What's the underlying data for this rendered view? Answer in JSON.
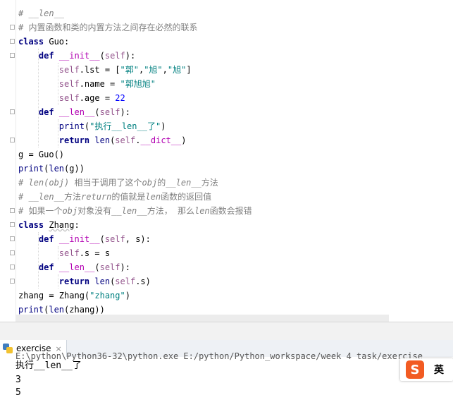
{
  "editor": {
    "lines": [
      {
        "parts": [
          {
            "t": "# __len__",
            "c": "cm"
          }
        ]
      },
      {
        "parts": [
          {
            "t": "# 内置函数和类的内置方法之间存在必然的联系",
            "c": "cmz"
          }
        ]
      },
      {
        "parts": [
          {
            "t": "class ",
            "c": "kw"
          },
          {
            "t": "Guo",
            "c": "cls-def"
          },
          {
            "t": ":",
            "c": ""
          }
        ]
      },
      {
        "parts": [
          {
            "t": "    ",
            "c": ""
          },
          {
            "t": "def ",
            "c": "kw"
          },
          {
            "t": "__init__",
            "c": "fn-special"
          },
          {
            "t": "(",
            "c": ""
          },
          {
            "t": "self",
            "c": "slf"
          },
          {
            "t": "):",
            "c": ""
          }
        ]
      },
      {
        "parts": [
          {
            "t": "        ",
            "c": ""
          },
          {
            "t": "self",
            "c": "slf"
          },
          {
            "t": ".lst = [",
            "c": ""
          },
          {
            "t": "\"郭\"",
            "c": "str"
          },
          {
            "t": ",",
            "c": ""
          },
          {
            "t": "\"旭\"",
            "c": "str"
          },
          {
            "t": ",",
            "c": ""
          },
          {
            "t": "\"旭\"",
            "c": "str"
          },
          {
            "t": "]",
            "c": ""
          }
        ]
      },
      {
        "parts": [
          {
            "t": "        ",
            "c": ""
          },
          {
            "t": "self",
            "c": "slf"
          },
          {
            "t": ".name = ",
            "c": ""
          },
          {
            "t": "\"郭旭旭\"",
            "c": "str"
          }
        ]
      },
      {
        "parts": [
          {
            "t": "        ",
            "c": ""
          },
          {
            "t": "self",
            "c": "slf"
          },
          {
            "t": ".age = ",
            "c": ""
          },
          {
            "t": "22",
            "c": "num"
          }
        ]
      },
      {
        "parts": [
          {
            "t": "    ",
            "c": ""
          },
          {
            "t": "def ",
            "c": "kw"
          },
          {
            "t": "__len__",
            "c": "fn-special"
          },
          {
            "t": "(",
            "c": ""
          },
          {
            "t": "self",
            "c": "slf"
          },
          {
            "t": "):",
            "c": ""
          }
        ]
      },
      {
        "parts": [
          {
            "t": "        ",
            "c": ""
          },
          {
            "t": "print",
            "c": "bi"
          },
          {
            "t": "(",
            "c": ""
          },
          {
            "t": "\"执行__len__了\"",
            "c": "str"
          },
          {
            "t": ")",
            "c": ""
          }
        ]
      },
      {
        "parts": [
          {
            "t": "        ",
            "c": ""
          },
          {
            "t": "return ",
            "c": "kw"
          },
          {
            "t": "len",
            "c": "bi"
          },
          {
            "t": "(",
            "c": ""
          },
          {
            "t": "self",
            "c": "slf"
          },
          {
            "t": ".",
            "c": ""
          },
          {
            "t": "__dict__",
            "c": "fn-special"
          },
          {
            "t": ")",
            "c": ""
          }
        ]
      },
      {
        "parts": [
          {
            "t": "g = Guo()",
            "c": ""
          }
        ]
      },
      {
        "parts": [
          {
            "t": "print",
            "c": "bi"
          },
          {
            "t": "(",
            "c": ""
          },
          {
            "t": "len",
            "c": "bi"
          },
          {
            "t": "(g))",
            "c": ""
          }
        ]
      },
      {
        "parts": [
          {
            "t": "# len(obj) ",
            "c": "cm"
          },
          {
            "t": "相当于调用了这个",
            "c": "cmz"
          },
          {
            "t": "obj",
            "c": "cm"
          },
          {
            "t": "的",
            "c": "cmz"
          },
          {
            "t": "__len__",
            "c": "cm"
          },
          {
            "t": "方法",
            "c": "cmz"
          }
        ]
      },
      {
        "parts": [
          {
            "t": "# __len__",
            "c": "cm"
          },
          {
            "t": "方法",
            "c": "cmz"
          },
          {
            "t": "return",
            "c": "cm"
          },
          {
            "t": "的值就是",
            "c": "cmz"
          },
          {
            "t": "len",
            "c": "cm"
          },
          {
            "t": "函数的返回值",
            "c": "cmz"
          }
        ]
      },
      {
        "parts": [
          {
            "t": "# 如果一个",
            "c": "cmz"
          },
          {
            "t": "obj",
            "c": "cm"
          },
          {
            "t": "对象没有",
            "c": "cmz"
          },
          {
            "t": "__len__",
            "c": "cm"
          },
          {
            "t": "方法， 那么",
            "c": "cmz"
          },
          {
            "t": "len",
            "c": "cm"
          },
          {
            "t": "函数会报错",
            "c": "cmz"
          }
        ]
      },
      {
        "parts": [
          {
            "t": "class ",
            "c": "kw"
          },
          {
            "t": "Zhang",
            "c": "cls-def underline-warn"
          },
          {
            "t": ":",
            "c": ""
          }
        ]
      },
      {
        "parts": [
          {
            "t": "    ",
            "c": ""
          },
          {
            "t": "def ",
            "c": "kw"
          },
          {
            "t": "__init__",
            "c": "fn-special"
          },
          {
            "t": "(",
            "c": ""
          },
          {
            "t": "self",
            "c": "slf"
          },
          {
            "t": ", s):",
            "c": ""
          }
        ]
      },
      {
        "parts": [
          {
            "t": "        ",
            "c": ""
          },
          {
            "t": "self",
            "c": "slf"
          },
          {
            "t": ".s = s",
            "c": ""
          }
        ]
      },
      {
        "parts": [
          {
            "t": "    ",
            "c": ""
          },
          {
            "t": "def ",
            "c": "kw"
          },
          {
            "t": "__len__",
            "c": "fn-special"
          },
          {
            "t": "(",
            "c": ""
          },
          {
            "t": "self",
            "c": "slf"
          },
          {
            "t": "):",
            "c": ""
          }
        ]
      },
      {
        "parts": [
          {
            "t": "        ",
            "c": ""
          },
          {
            "t": "return ",
            "c": "kw"
          },
          {
            "t": "len",
            "c": "bi"
          },
          {
            "t": "(",
            "c": ""
          },
          {
            "t": "self",
            "c": "slf"
          },
          {
            "t": ".s)",
            "c": ""
          }
        ]
      },
      {
        "parts": [
          {
            "t": "zhang = Zhang(",
            "c": ""
          },
          {
            "t": "\"zhang\"",
            "c": "str"
          },
          {
            "t": ")",
            "c": ""
          }
        ]
      },
      {
        "parts": [
          {
            "t": "print",
            "c": "bi"
          },
          {
            "t": "(",
            "c": ""
          },
          {
            "t": "len",
            "c": "bi"
          },
          {
            "t": "(zhang))",
            "c": ""
          }
        ]
      }
    ]
  },
  "run_panel": {
    "tab_label": "exercise",
    "tab_close": "×",
    "command": "E:\\python\\Python36-32\\python.exe E:/python/Python_workspace/week 4 task/exercise",
    "output": [
      "执行__len__了",
      "3",
      "5"
    ]
  },
  "ime": {
    "logo": "S",
    "lang": "英"
  },
  "icons": [
    "python-file-icon",
    "close-icon",
    "sogou-ime-icon",
    "fold-icon"
  ]
}
